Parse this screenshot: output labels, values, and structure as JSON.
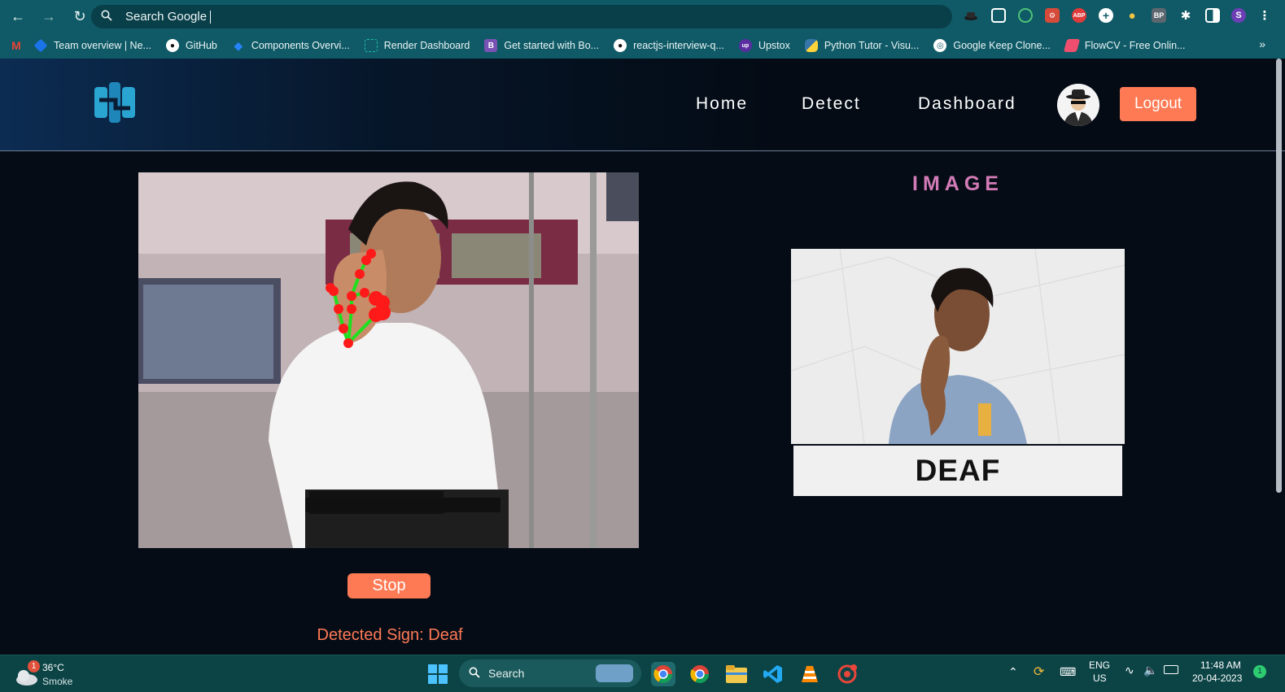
{
  "browser": {
    "address_placeholder": "Search Google",
    "profile_initial": "S",
    "bookmarks": [
      {
        "label": "Team overview | Ne...",
        "icon": "diamond-icon",
        "color": "#1a73e8"
      },
      {
        "label": "GitHub",
        "icon": "github-icon",
        "color": "#ffffff"
      },
      {
        "label": "Components Overvi...",
        "icon": "jira-icon",
        "color": "#2684ff"
      },
      {
        "label": "Render Dashboard",
        "icon": "render-icon",
        "color": "#1fbfa5"
      },
      {
        "label": "Get started with Bo...",
        "icon": "bootstrap-icon",
        "color": "#7952b3"
      },
      {
        "label": "reactjs-interview-q...",
        "icon": "github-icon",
        "color": "#ffffff"
      },
      {
        "label": "Upstox",
        "icon": "upstox-icon",
        "color": "#5a2ca0"
      },
      {
        "label": "Python Tutor - Visu...",
        "icon": "python-icon",
        "color": "#3776ab"
      },
      {
        "label": "Google Keep Clone...",
        "icon": "globe-icon",
        "color": "#ffffff"
      },
      {
        "label": "FlowCV - Free Onlin...",
        "icon": "flowcv-icon",
        "color": "#f04e6e"
      }
    ],
    "more_label": "»"
  },
  "app": {
    "nav": {
      "home": "Home",
      "detect": "Detect",
      "dashboard": "Dashboard"
    },
    "logout_label": "Logout",
    "image_title": "IMAGE",
    "sign_label": "DEAF",
    "stop_label": "Stop",
    "detected_text": "Detected Sign: Deaf",
    "accent_color": "#fe7a55",
    "title_color": "#d37bb6"
  },
  "taskbar": {
    "weather_badge": "1",
    "temperature": "36°C",
    "weather_desc": "Smoke",
    "search_label": "Search",
    "language": "ENG",
    "region": "US",
    "time": "11:48 AM",
    "date": "20-04-2023",
    "notification_count": "1"
  }
}
